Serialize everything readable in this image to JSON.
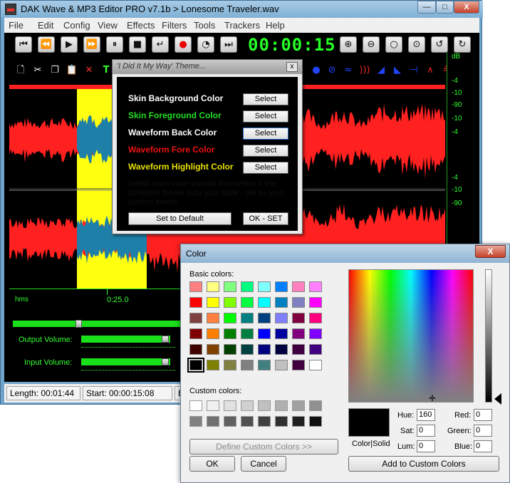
{
  "window": {
    "title": "DAK Wave & MP3 Editor PRO v7.1b > Lonesome Traveler.wav",
    "minimize": "—",
    "maximize": "□",
    "close": "X"
  },
  "menu": [
    "File",
    "Edit",
    "Config",
    "View",
    "Effects",
    "Filters",
    "Tools",
    "Trackers",
    "Help"
  ],
  "transport": {
    "time": "00:00:15.0",
    "icons": [
      "skip-start-icon",
      "rewind-icon",
      "play-icon",
      "fast-forward-icon",
      "pause-icon",
      "stop-icon",
      "loop-icon",
      "record-icon",
      "clock-icon",
      "skip-end-icon",
      "zoom-in-icon",
      "zoom-out-icon",
      "zoom-fit-icon",
      "zoom-selection-icon",
      "undo-icon",
      "redo-icon"
    ]
  },
  "waveform": {
    "db_labels": [
      "dB",
      "-4",
      "-10",
      "-90",
      "-10",
      "-4",
      "-4",
      "-10",
      "-90"
    ],
    "timeline_unit": "hms",
    "timeline_mark": "0:25.0",
    "colors": {
      "background": "#000000",
      "fore": "#ff2020",
      "highlight": "#ffff10",
      "selection_wave": "#1e7fa8"
    }
  },
  "volumes": {
    "output_label": "Output Volume:",
    "input_label": "Input Volume:",
    "output_level": 0.95,
    "input_level": 0.95
  },
  "status": {
    "length": "Length: 00:01:44",
    "start": "Start: 00:00:15:08",
    "end": "En"
  },
  "theme_dialog": {
    "title": "'I Did It My Way' Theme...",
    "close": "x",
    "rows": [
      {
        "label": "Skin Background Color",
        "color": "#000000",
        "button": "Select"
      },
      {
        "label": "Skin Foreground Color",
        "color": "#22dd22",
        "button": "Select"
      },
      {
        "label": "Waveform  Back Color",
        "color": "#000000",
        "button": "Select"
      },
      {
        "label": "Waveform  Fore Color",
        "color": "#ee1111",
        "button": "Select"
      },
      {
        "label": "Waveform Highlight Color",
        "color": "#e8e000",
        "button": "Select"
      }
    ],
    "help": "Select each color wanted then when/ if the complete theme suits your taste - set as your custom theme.",
    "default_button": "Set to Default",
    "ok_button": "OK - SET"
  },
  "color_dialog": {
    "title": "Color",
    "close": "X",
    "basic_label": "Basic colors:",
    "custom_label": "Custom colors:",
    "basic_colors": [
      "#ff8080",
      "#ffff80",
      "#80ff80",
      "#00ff80",
      "#80ffff",
      "#0080ff",
      "#ff80c0",
      "#ff80ff",
      "#ff0000",
      "#ffff00",
      "#80ff00",
      "#00ff40",
      "#00ffff",
      "#0080c0",
      "#8080c0",
      "#ff00ff",
      "#804040",
      "#ff8040",
      "#00ff00",
      "#008080",
      "#004080",
      "#8080ff",
      "#800040",
      "#ff0080",
      "#800000",
      "#ff8000",
      "#008000",
      "#008040",
      "#0000ff",
      "#0000a0",
      "#800080",
      "#8000ff",
      "#400000",
      "#804000",
      "#004000",
      "#004040",
      "#000080",
      "#000040",
      "#400040",
      "#400080",
      "#000000",
      "#808000",
      "#808040",
      "#808080",
      "#408080",
      "#c0c0c0",
      "#400040",
      "#ffffff"
    ],
    "custom_colors": [
      "#ffffff",
      "#f0f0f0",
      "#e0e0e0",
      "#d0d0d0",
      "#c0c0c0",
      "#b0b0b0",
      "#a0a0a0",
      "#909090",
      "#808080",
      "#707070",
      "#606060",
      "#505050",
      "#404040",
      "#303030",
      "#202020",
      "#101010"
    ],
    "define_button": "Define Custom Colors >>",
    "ok_button": "OK",
    "cancel_button": "Cancel",
    "add_button": "Add to Custom Colors",
    "preview_label": "Color|Solid",
    "hue_label": "Hue:",
    "hue": "160",
    "sat_label": "Sat:",
    "sat": "0",
    "lum_label": "Lum:",
    "lum": "0",
    "red_label": "Red:",
    "red": "0",
    "green_label": "Green:",
    "green": "0",
    "blue_label": "Blue:",
    "blue": "0"
  }
}
